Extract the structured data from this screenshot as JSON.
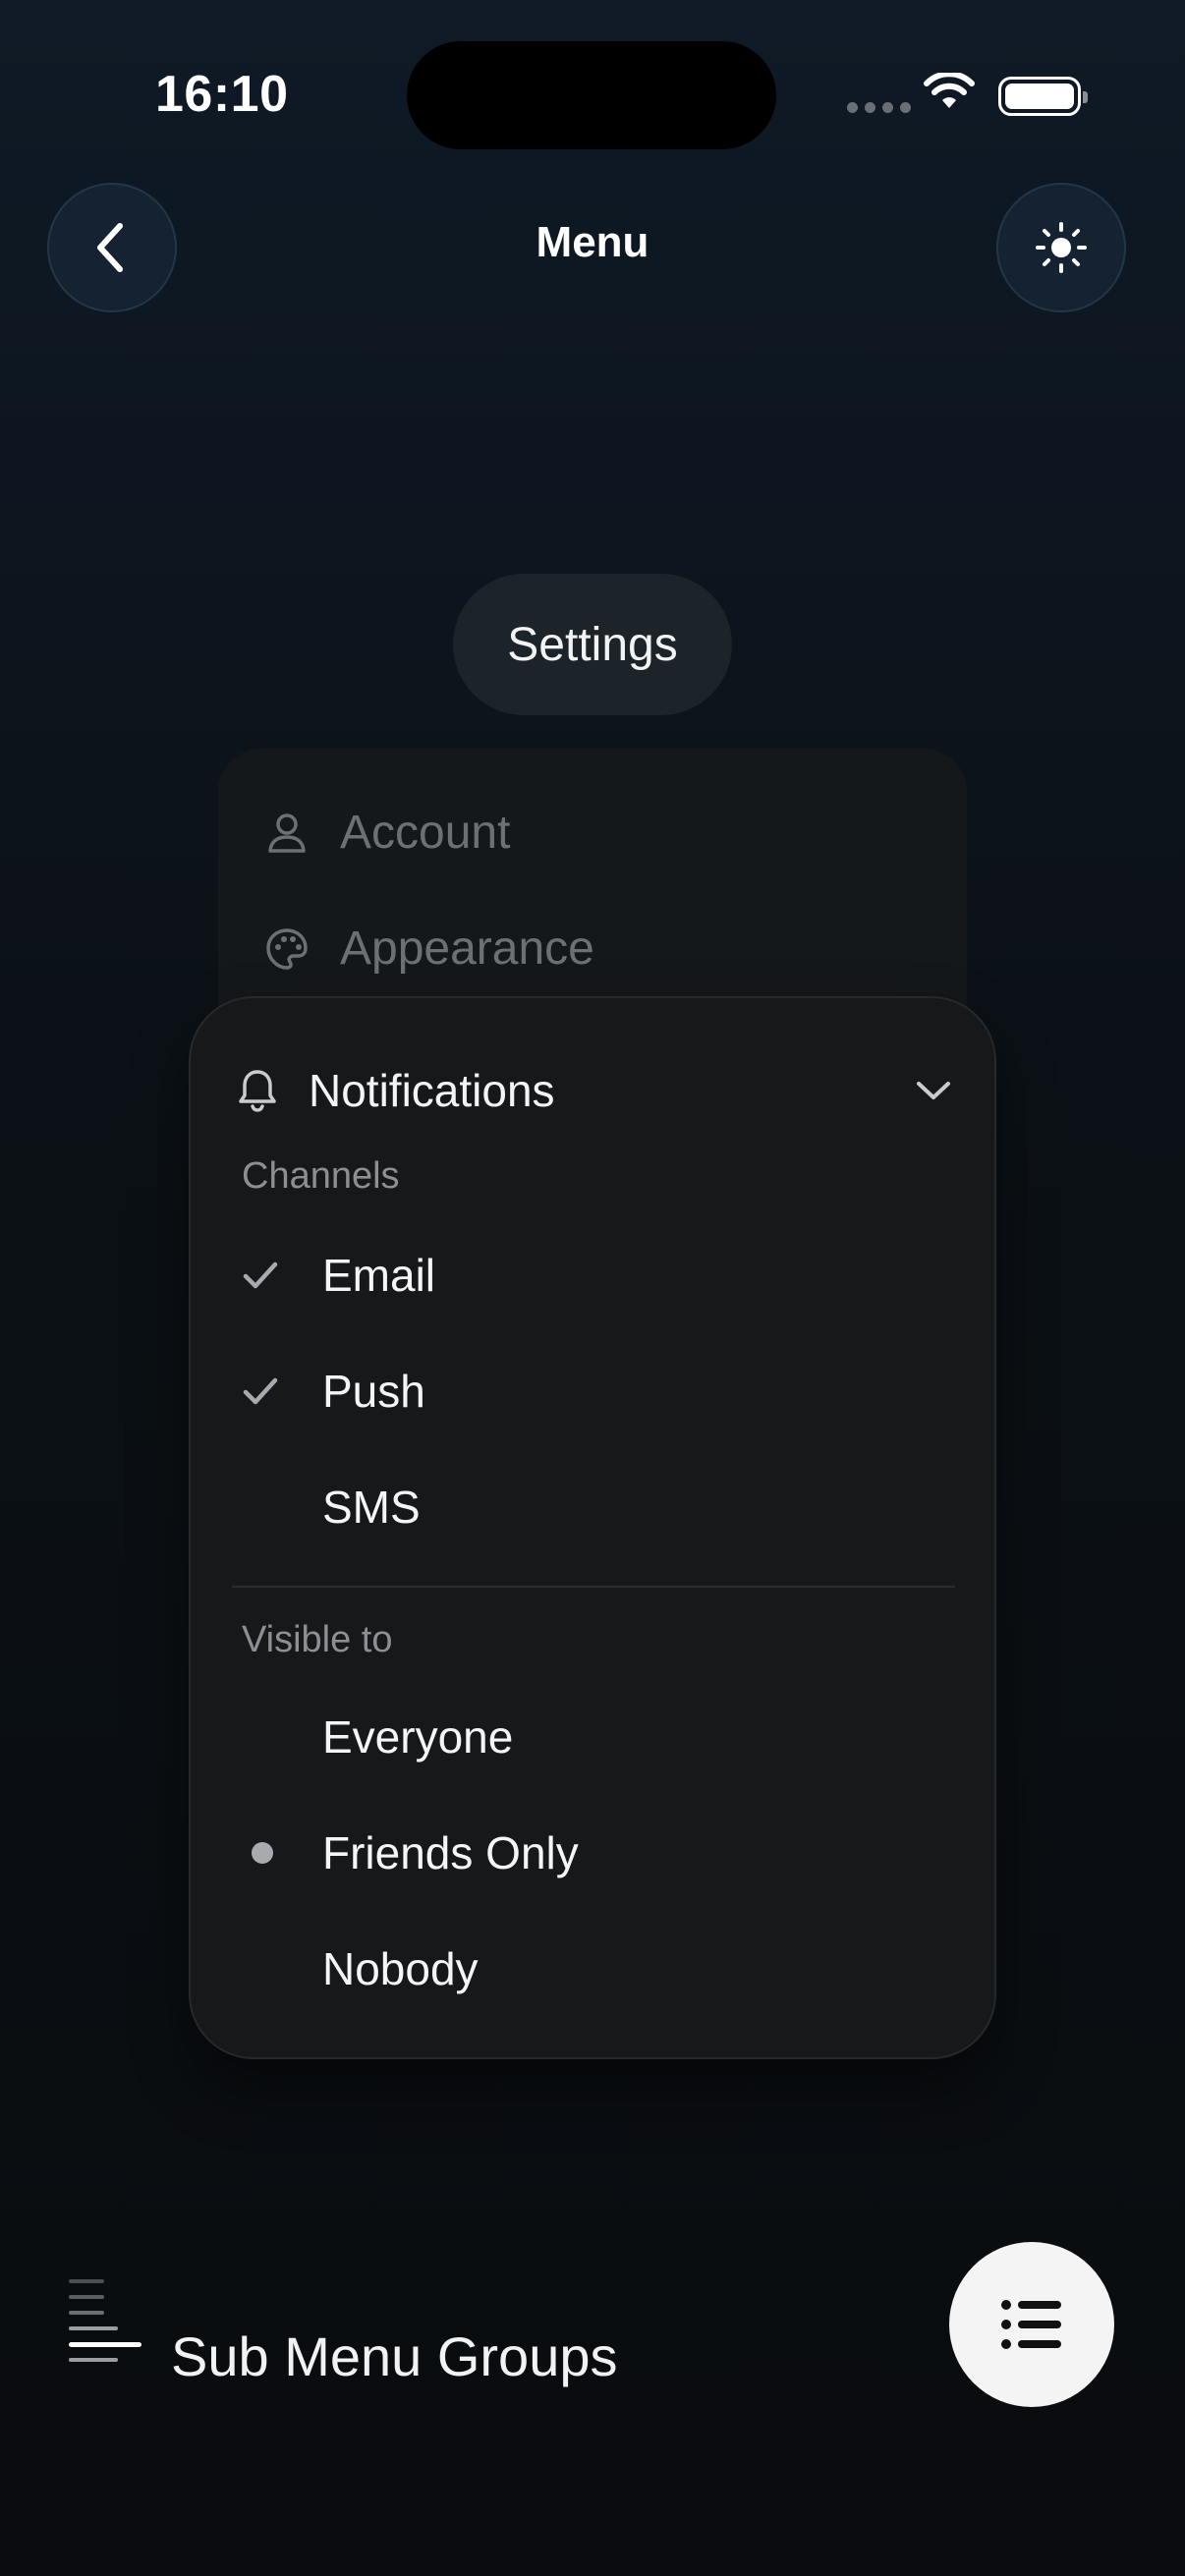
{
  "status_bar": {
    "time": "16:10"
  },
  "header": {
    "title": "Menu",
    "back_icon": "chevron-left-icon",
    "theme_icon": "sun-icon"
  },
  "settings_button": {
    "label": "Settings"
  },
  "menu_items": [
    {
      "label": "Account",
      "icon": "person-icon"
    },
    {
      "label": "Appearance",
      "icon": "palette-icon"
    }
  ],
  "dropdown": {
    "title": "Notifications",
    "icon": "bell-icon",
    "channels": {
      "label": "Channels",
      "options": [
        {
          "label": "Email",
          "checked": true
        },
        {
          "label": "Push",
          "checked": true
        },
        {
          "label": "SMS",
          "checked": false
        }
      ]
    },
    "visibility": {
      "label": "Visible to",
      "options": [
        {
          "label": "Everyone",
          "selected": false
        },
        {
          "label": "Friends Only",
          "selected": true
        },
        {
          "label": "Nobody",
          "selected": false
        }
      ]
    }
  },
  "footer": {
    "label": "Sub Menu Groups"
  },
  "colors": {
    "accent_fab": "#f4f4f4",
    "panel_bg": "#161819",
    "page_bg": "#0a0c0f"
  }
}
